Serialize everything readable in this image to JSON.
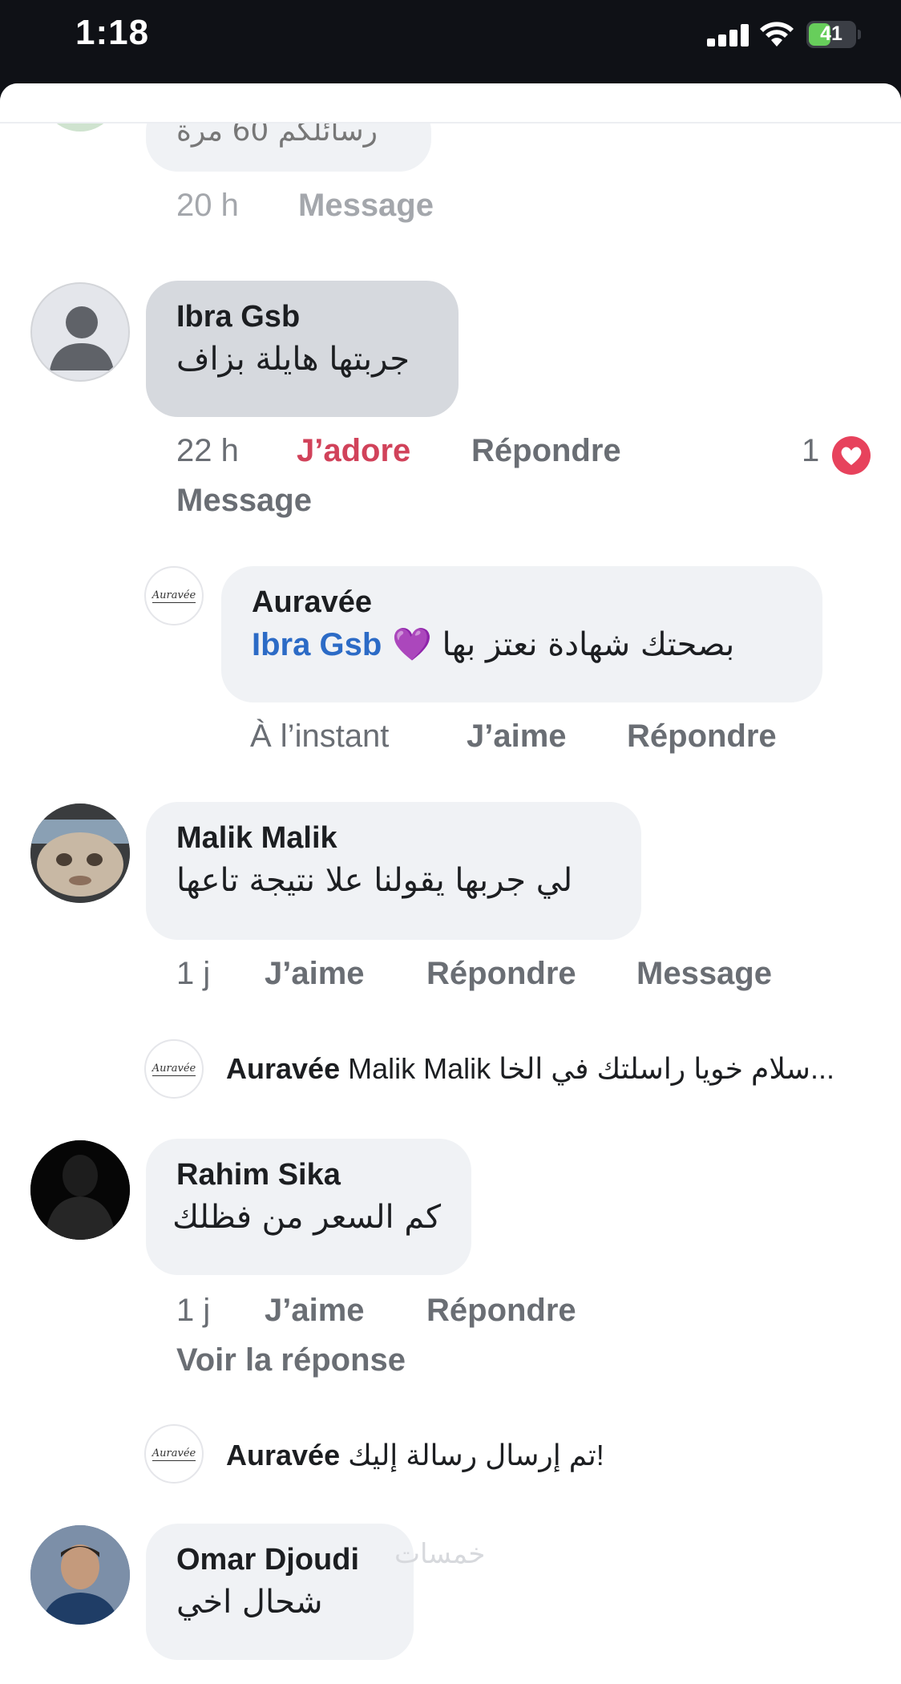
{
  "status_bar": {
    "time": "1:18",
    "battery": "41"
  },
  "top_partial": {
    "text": "رسائلكم 60 مرة",
    "time": "20 h",
    "message": "Message"
  },
  "comments": [
    {
      "author": "Ibra Gsb",
      "text": "جربتها هايلة بزاف",
      "time": "22 h",
      "reaction_label": "J’adore",
      "reply_label": "Répondre",
      "message_label": "Message",
      "reaction_count": "1",
      "reply": {
        "author": "Auravée",
        "tag": "Ibra Gsb",
        "text": "بصحتك شهادة نعتز بها 💜",
        "time": "À l’instant",
        "like_label": "J’aime",
        "reply_label": "Répondre"
      }
    },
    {
      "author": "Malik Malik",
      "text": "لي جربها يقولنا علا نتيجة تاعها",
      "time": "1 j",
      "like_label": "J’aime",
      "reply_label": "Répondre",
      "message_label": "Message",
      "inline_reply": {
        "author": "Auravée",
        "text": "Malik Malik سلام خويا راسلتك في الخا..."
      }
    },
    {
      "author": "Rahim Sika",
      "text": "كم السعر من فظلك",
      "time": "1 j",
      "like_label": "J’aime",
      "reply_label": "Répondre",
      "view_reply_label": "Voir la réponse",
      "inline_reply": {
        "author": "Auravée",
        "text": "تم إرسال رسالة إليك!"
      }
    },
    {
      "author": "Omar Djoudi",
      "text": "شحال اخي"
    }
  ],
  "page_logo": "Auravée",
  "watermark": "خمسات",
  "colors": {
    "reaction_red": "#d1425a",
    "tag_blue": "#2c6bc6",
    "bubble": "#f0f2f5",
    "bubble_pressed": "#d6d9de"
  }
}
